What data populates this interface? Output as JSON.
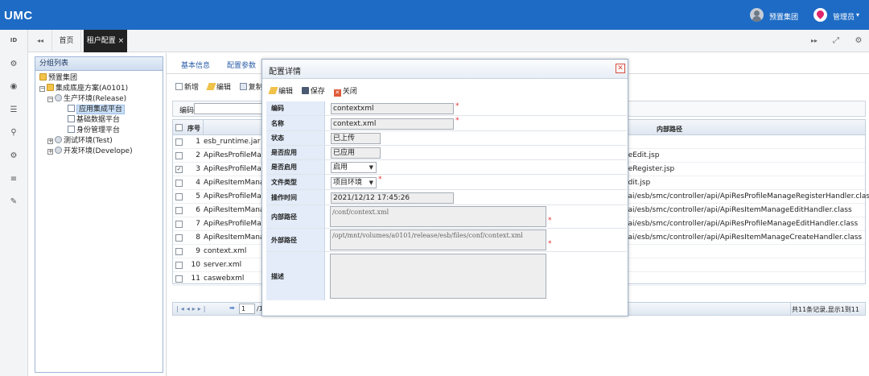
{
  "app": {
    "logo": "UMC"
  },
  "header": {
    "org_label": "预置集团",
    "user_label": "管理员",
    "user_caret": "▾"
  },
  "tabs": {
    "nav_back": "◂◂",
    "home": "首页",
    "active": "租户配置 ×",
    "nav_forward": "▸▸",
    "expand": "⤢",
    "settings": "⚙"
  },
  "sidebar_icons": [
    "ID",
    "⚙",
    "◉",
    "☰",
    "⚲",
    "⚙",
    "≡",
    "✎"
  ],
  "tree_panel": {
    "title": "分组列表",
    "nodes": [
      {
        "label": "预置集团"
      },
      {
        "label": "集成底座方案(A0101)"
      },
      {
        "label": "生产环境(Release)"
      },
      {
        "label": "应用集成平台"
      },
      {
        "label": "基础数据平台"
      },
      {
        "label": "身份管理平台"
      },
      {
        "label": "测试环境(Test)"
      },
      {
        "label": "开发环境(Develope)"
      }
    ]
  },
  "main": {
    "subtabs": [
      "基本信息",
      "配置参数"
    ],
    "toolbar": {
      "add": "新增",
      "edit": "编辑",
      "copy": "复制"
    },
    "filter_label": "编码",
    "columns": {
      "index": "序号",
      "path": "内部路径"
    },
    "rows": [
      {
        "no": "1",
        "name": "esb_runtime.jar",
        "path": "",
        "checked": false
      },
      {
        "no": "2",
        "name": "ApiResProfileMana",
        "path": "geEdit.jsp",
        "checked": false
      },
      {
        "no": "3",
        "name": "ApiResProfileMana",
        "path": "geRegister.jsp",
        "checked": true
      },
      {
        "no": "4",
        "name": "ApiResItemManag",
        "path": "Edit.jsp",
        "checked": false
      },
      {
        "no": "5",
        "name": "ApiResProfileMana",
        "path": "eai/esb/smc/controller/api/ApiResProfileManageRegisterHandler.class",
        "checked": false
      },
      {
        "no": "6",
        "name": "ApiResItemManag",
        "path": "eai/esb/smc/controller/api/ApiResItemManageEditHandler.class",
        "checked": false
      },
      {
        "no": "7",
        "name": "ApiResProfileMana",
        "path": "eai/esb/smc/controller/api/ApiResProfileManageEditHandler.class",
        "checked": false
      },
      {
        "no": "8",
        "name": "ApiResItemManag",
        "path": "eai/esb/smc/controller/api/ApiResItemManageCreateHandler.class",
        "checked": false
      },
      {
        "no": "9",
        "name": "context.xml",
        "path": "",
        "checked": false
      },
      {
        "no": "10",
        "name": "server.xml",
        "path": "",
        "checked": false
      },
      {
        "no": "11",
        "name": "caswebxml",
        "path": "",
        "checked": false
      }
    ],
    "pager": {
      "page_value": "1",
      "page_suffix": "/1",
      "summary": "共11条记录,显示1到11"
    }
  },
  "modal": {
    "title": "配置详情",
    "close": "✕",
    "toolbar": {
      "edit": "编辑",
      "save": "保存",
      "close": "关闭"
    },
    "fields": {
      "code": {
        "label": "编码",
        "value": "contextxml"
      },
      "name": {
        "label": "名称",
        "value": "context.xml"
      },
      "status": {
        "label": "状态",
        "value": "已上传"
      },
      "applied": {
        "label": "是否应用",
        "value": "已应用"
      },
      "enabled": {
        "label": "是否启用",
        "value": "启用"
      },
      "file_type": {
        "label": "文件类型",
        "value": "项目环境"
      },
      "op_time": {
        "label": "操作时间",
        "value": "2021/12/12 17:45:26"
      },
      "inner_path": {
        "label": "内部路径",
        "value": "/conf/context.xml"
      },
      "outer_path": {
        "label": "外部路径",
        "value": "/opt/mnt/volumes/a0101/release/esb/files/conf/context.xml"
      },
      "desc": {
        "label": "描述",
        "value": ""
      }
    },
    "required_mark": "*"
  },
  "colors": {
    "topbar": "#1d6bc4",
    "tab_active": "#222222",
    "label_bg": "#e3ecf8",
    "required": "#e03030"
  }
}
